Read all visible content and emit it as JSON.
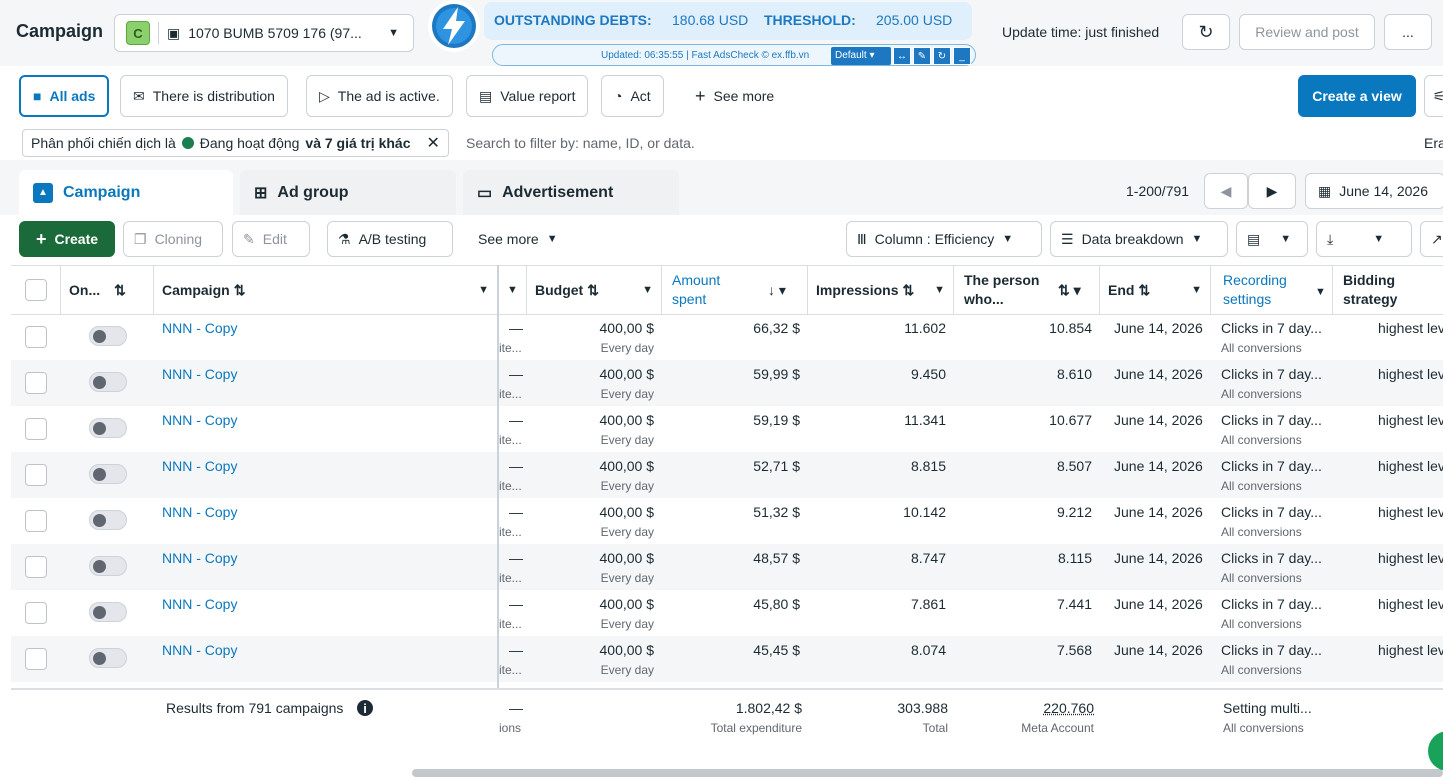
{
  "header": {
    "title": "Campaign",
    "account_badge": "C",
    "account_name": "1070 BUMB 5709 176 (97...",
    "update_time": "Update time: just finished",
    "review_label": "Review and post",
    "more_label": "..."
  },
  "extension": {
    "debt_label": "OUTSTANDING DEBTS:",
    "debt_value": "180.68 USD",
    "threshold_label": "THRESHOLD:",
    "threshold_value": "205.00 USD",
    "updated_text": "Updated: 06:35:55 | Fast AdsCheck © ex.ffb.vn",
    "preset": "Default"
  },
  "filters": {
    "all_ads": "All ads",
    "distribution": "There is distribution",
    "active": "The ad is active.",
    "value_report": "Value report",
    "act": "Act",
    "see_more": "See more",
    "create_view": "Create a view"
  },
  "filter_chip": {
    "prefix": "Phân phối chiến dịch là",
    "status": "Đang hoạt động",
    "suffix": "và 7 giá trị khác"
  },
  "search": {
    "placeholder": "Search to filter by: name, ID, or data.",
    "erase": "Era"
  },
  "tabs": {
    "campaign": "Campaign",
    "ad_group": "Ad group",
    "advertisement": "Advertisement"
  },
  "pager": {
    "range": "1-200/791",
    "date": "June 14, 2026"
  },
  "toolbar": {
    "create": "Create",
    "cloning": "Cloning",
    "edit": "Edit",
    "ab_testing": "A/B testing",
    "see_more": "See more",
    "columns": "Column : Efficiency",
    "breakdown": "Data breakdown"
  },
  "columns": {
    "on": "On...",
    "campaign": "Campaign",
    "budget": "Budget",
    "amount_spent_1": "Amount",
    "amount_spent_2": "spent",
    "impressions": "Impressions",
    "person_1": "The person",
    "person_2": "who...",
    "end": "End",
    "recording_1": "Recording",
    "recording_2": "settings",
    "bidding_1": "Bidding",
    "bidding_2": "strategy"
  },
  "rows": [
    {
      "name": "NNN - Copy",
      "dash": "—",
      "partial": "ite...",
      "budget": "400,00 $",
      "budget_sub": "Every day",
      "spent": "66,32 $",
      "impressions": "11.602",
      "reach": "10.854",
      "end": "June 14, 2026",
      "rec": "Clicks in 7 day...",
      "rec_sub": "All conversions",
      "bid": "highest lev"
    },
    {
      "name": "NNN - Copy",
      "dash": "—",
      "partial": "ite...",
      "budget": "400,00 $",
      "budget_sub": "Every day",
      "spent": "59,99 $",
      "impressions": "9.450",
      "reach": "8.610",
      "end": "June 14, 2026",
      "rec": "Clicks in 7 day...",
      "rec_sub": "All conversions",
      "bid": "highest lev"
    },
    {
      "name": "NNN - Copy",
      "dash": "—",
      "partial": "ite...",
      "budget": "400,00 $",
      "budget_sub": "Every day",
      "spent": "59,19 $",
      "impressions": "11.341",
      "reach": "10.677",
      "end": "June 14, 2026",
      "rec": "Clicks in 7 day...",
      "rec_sub": "All conversions",
      "bid": "highest lev"
    },
    {
      "name": "NNN - Copy",
      "dash": "—",
      "partial": "ite...",
      "budget": "400,00 $",
      "budget_sub": "Every day",
      "spent": "52,71 $",
      "impressions": "8.815",
      "reach": "8.507",
      "end": "June 14, 2026",
      "rec": "Clicks in 7 day...",
      "rec_sub": "All conversions",
      "bid": "highest lev"
    },
    {
      "name": "NNN - Copy",
      "dash": "—",
      "partial": "ite...",
      "budget": "400,00 $",
      "budget_sub": "Every day",
      "spent": "51,32 $",
      "impressions": "10.142",
      "reach": "9.212",
      "end": "June 14, 2026",
      "rec": "Clicks in 7 day...",
      "rec_sub": "All conversions",
      "bid": "highest lev"
    },
    {
      "name": "NNN - Copy",
      "dash": "—",
      "partial": "ite...",
      "budget": "400,00 $",
      "budget_sub": "Every day",
      "spent": "48,57 $",
      "impressions": "8.747",
      "reach": "8.115",
      "end": "June 14, 2026",
      "rec": "Clicks in 7 day...",
      "rec_sub": "All conversions",
      "bid": "highest lev"
    },
    {
      "name": "NNN - Copy",
      "dash": "—",
      "partial": "ite...",
      "budget": "400,00 $",
      "budget_sub": "Every day",
      "spent": "45,80 $",
      "impressions": "7.861",
      "reach": "7.441",
      "end": "June 14, 2026",
      "rec": "Clicks in 7 day...",
      "rec_sub": "All conversions",
      "bid": "highest lev"
    },
    {
      "name": "NNN - Copy",
      "dash": "—",
      "partial": "ite...",
      "budget": "400,00 $",
      "budget_sub": "Every day",
      "spent": "45,45 $",
      "impressions": "8.074",
      "reach": "7.568",
      "end": "June 14, 2026",
      "rec": "Clicks in 7 day...",
      "rec_sub": "All conversions",
      "bid": "highest lev"
    }
  ],
  "footer": {
    "results": "Results from 791 campaigns",
    "dash": "—",
    "partial": "ions",
    "spent": "1.802,42 $",
    "spent_sub": "Total expenditure",
    "impressions": "303.988",
    "impressions_sub": "Total",
    "reach": "220.760",
    "reach_sub": "Meta Account",
    "rec": "Setting multi...",
    "rec_sub": "All conversions"
  }
}
